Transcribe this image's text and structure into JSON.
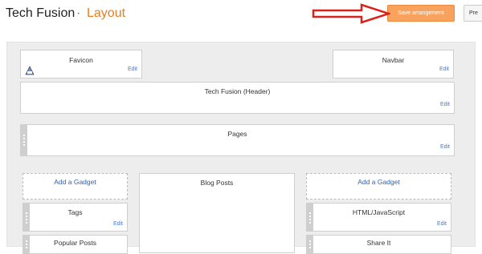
{
  "header": {
    "blog_name": "Tech Fusion",
    "separator": "·",
    "page_title": "Layout",
    "save_button": "Save arrangement",
    "preview_button": "Pre"
  },
  "widgets": {
    "favicon": {
      "title": "Favicon",
      "edit": "Edit"
    },
    "navbar": {
      "title": "Navbar",
      "edit": "Edit"
    },
    "header": {
      "title": "Tech Fusion (Header)",
      "edit": "Edit"
    },
    "pages": {
      "title": "Pages",
      "edit": "Edit"
    },
    "blog_posts": {
      "title": "Blog Posts"
    },
    "left_add_gadget": "Add a Gadget",
    "right_add_gadget": "Add a Gadget",
    "tags": {
      "title": "Tags",
      "edit": "Edit"
    },
    "popular_posts": {
      "title": "Popular Posts"
    },
    "html_js": {
      "title": "HTML/JavaScript",
      "edit": "Edit"
    },
    "share_it": {
      "title": "Share It"
    }
  },
  "colors": {
    "accent_orange": "#e67e22",
    "save_button_bg": "#f9a25d",
    "arrow_red": "#d9221c",
    "link_blue": "#2f62b0"
  },
  "icons": {
    "favicon": "blogger-favicon-icon",
    "annotation": "red-arrow-icon"
  }
}
